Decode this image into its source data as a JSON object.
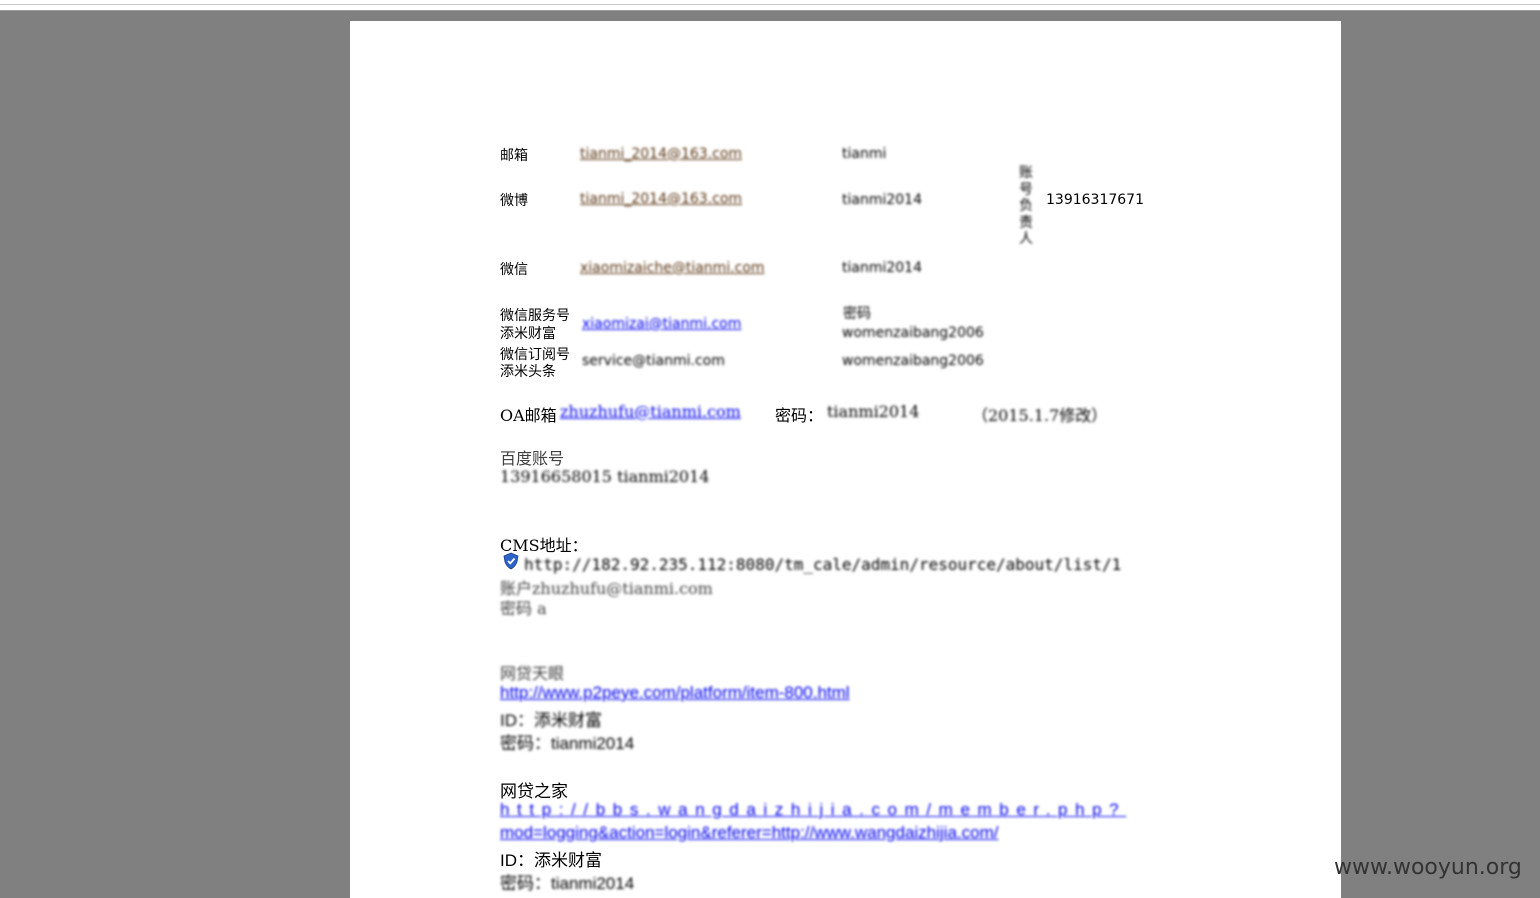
{
  "contacts": {
    "email": {
      "label": "邮箱",
      "account": "tianmi_2014@163.com",
      "password": "tianmi"
    },
    "weibo": {
      "label": "微博",
      "account": "tianmi_2014@163.com",
      "password": "tianmi2014"
    },
    "wechat": {
      "label": "微信",
      "account": "xiaomizaiche@tianmi.com",
      "password": "tianmi2014"
    },
    "wechat_service": {
      "label_line1": "微信服务号",
      "label_line2": "添米财富",
      "account": "xiaomizai@tianmi.com",
      "pw_heading": "密码",
      "password": "womenzaibang2006"
    },
    "wechat_sub": {
      "label_line1": "微信订阅号",
      "label_line2": "添米头条",
      "account": "service@tianmi.com",
      "password": "womenzaibang2006"
    },
    "vertical_note": "账号负责人",
    "phone": "13916317671"
  },
  "oa": {
    "label": "OA邮箱",
    "account": "zhuzhufu@tianmi.com",
    "pw_label": "密码：",
    "password": "tianmi2014",
    "note": "（2015.1.7修改）"
  },
  "baidu": {
    "title": "百度账号",
    "line": "13916658015 tianmi2014"
  },
  "cms": {
    "title": "CMS地址：",
    "url": "http://182.92.235.112:8080/tm_cale/admin/resource/about/list/1",
    "account": "账户zhuzhufu@tianmi.com",
    "password": "密码 a"
  },
  "p2p_sky": {
    "title": "网贷天眼",
    "url": "http://www.p2peye.com/platform/item-800.html",
    "id": "ID：添米财富",
    "password": "密码：tianmi2014"
  },
  "p2p_home": {
    "title": "网贷之家",
    "url_line1": "http://bbs.wangdaizhijia.com/member.php?",
    "url_line2": "mod=logging&action=login&referer=http://www.wangdaizhijia.com/",
    "id": "ID：添米财富",
    "password": "密码：tianmi2014"
  },
  "watermark": "www.wooyun.org"
}
